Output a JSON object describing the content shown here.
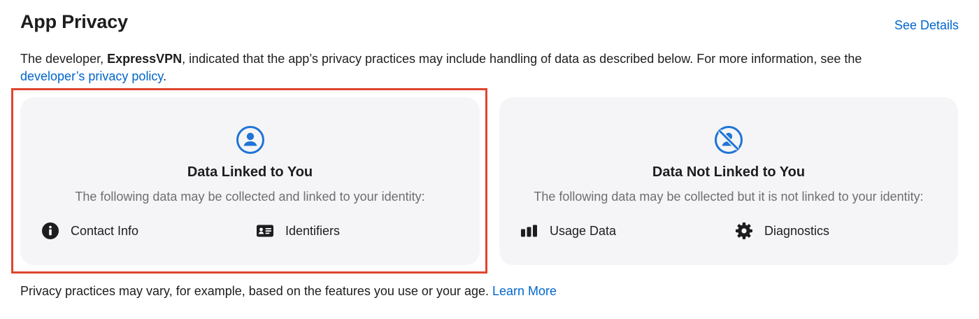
{
  "header": {
    "title": "App Privacy",
    "see_details_label": "See Details"
  },
  "intro": {
    "prefix": "The developer, ",
    "developer_name": "ExpressVPN",
    "middle": ", indicated that the app’s privacy practices may include handling of data as described below. For more information, see the",
    "policy_link": "developer’s privacy policy",
    "suffix": "."
  },
  "cards": {
    "linked": {
      "icon": "person-circle-icon",
      "title": "Data Linked to You",
      "description": "The following data may be collected and linked to your identity:",
      "items": [
        {
          "label": "Contact Info",
          "icon": "info-circle-icon"
        },
        {
          "label": "Identifiers",
          "icon": "id-card-icon"
        }
      ]
    },
    "not_linked": {
      "icon": "person-crossed-circle-icon",
      "title": "Data Not Linked to You",
      "description": "The following data may be collected but it is not linked to your identity:",
      "items": [
        {
          "label": "Usage Data",
          "icon": "bar-chart-icon"
        },
        {
          "label": "Diagnostics",
          "icon": "gear-icon"
        }
      ]
    }
  },
  "footer": {
    "text": "Privacy practices may vary, for example, based on the features you use or your age.",
    "learn_more_label": "Learn More"
  },
  "colors": {
    "accent": "#0066cc",
    "highlight": "#e0452f",
    "card_bg": "#f5f5f7",
    "icon_blue": "#1f74d6"
  }
}
